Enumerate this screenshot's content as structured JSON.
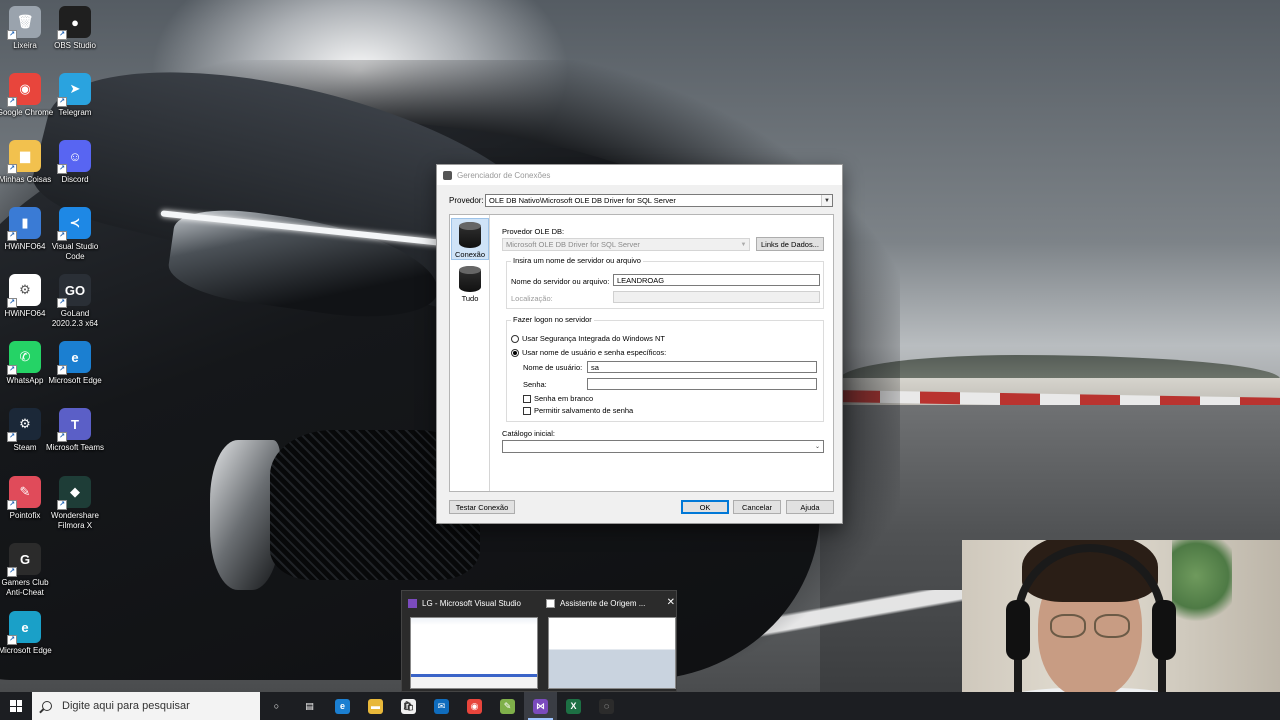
{
  "desktop": {
    "icons": [
      {
        "label": "Lixeira",
        "icon": "recycle-bin-icon",
        "color": "#9aa3ad",
        "glyph": "🗑"
      },
      {
        "label": "OBS Studio",
        "icon": "obs-icon",
        "color": "#1f1f1f",
        "glyph": "●"
      },
      {
        "label": "Google Chrome",
        "icon": "chrome-icon",
        "color": "#e8453c",
        "glyph": "◉"
      },
      {
        "label": "Telegram",
        "icon": "telegram-icon",
        "color": "#2aa3df",
        "glyph": "➤"
      },
      {
        "label": "Minhas Coisas",
        "icon": "folder-icon",
        "color": "#f2c14e",
        "glyph": "▆"
      },
      {
        "label": "Discord",
        "icon": "discord-icon",
        "color": "#5865f2",
        "glyph": "☺"
      },
      {
        "label": "HWiNFO64",
        "icon": "hwinfo-icon",
        "color": "#3a7bd5",
        "glyph": "▮"
      },
      {
        "label": "Visual Studio Code",
        "icon": "vscode-icon",
        "color": "#1e88e5",
        "glyph": "≺"
      },
      {
        "label": "HWiNFO64",
        "icon": "file-icon",
        "color": "#ffffff",
        "glyph": "⚙"
      },
      {
        "label": "GoLand 2020.2.3 x64",
        "icon": "goland-icon",
        "color": "#2a2f36",
        "glyph": "GO"
      },
      {
        "label": "WhatsApp",
        "icon": "whatsapp-icon",
        "color": "#25d366",
        "glyph": "✆"
      },
      {
        "label": "Microsoft Edge",
        "icon": "edge-icon",
        "color": "#1b7fd1",
        "glyph": "e"
      },
      {
        "label": "Steam",
        "icon": "steam-icon",
        "color": "#1b2838",
        "glyph": "⚙"
      },
      {
        "label": "Microsoft Teams",
        "icon": "teams-icon",
        "color": "#5b5fc7",
        "glyph": "T"
      },
      {
        "label": "Pointofix",
        "icon": "pointofix-icon",
        "color": "#e04b5a",
        "glyph": "✎"
      },
      {
        "label": "Wondershare Filmora X",
        "icon": "filmora-icon",
        "color": "#1e3d37",
        "glyph": "◆"
      },
      {
        "label": "Gamers Club Anti-Cheat",
        "icon": "gamersclub-icon",
        "color": "#2b2b2b",
        "glyph": "G"
      },
      {
        "label": "Microsoft Edge",
        "icon": "edge-icon",
        "color": "#1aa0c8",
        "glyph": "e"
      }
    ]
  },
  "dialog": {
    "title": "Gerenciador de Conexões",
    "provider_label": "Provedor:",
    "provider_value": "OLE DB Nativo\\Microsoft OLE DB Driver for SQL Server",
    "nav": [
      {
        "label": "Conexão",
        "selected": true
      },
      {
        "label": "Tudo",
        "selected": false
      }
    ],
    "ole_label": "Provedor OLE DB:",
    "ole_value": "Microsoft OLE DB Driver for SQL Server",
    "data_links_button": "Links de Dados...",
    "server_group_title": "Insira um nome de servidor ou arquivo",
    "server_label": "Nome do servidor ou arquivo:",
    "server_value": "LEANDROAG",
    "location_label": "Localização:",
    "logon_group_title": "Fazer logon no servidor",
    "radio_nt": "Usar Segurança Integrada do Windows NT",
    "radio_user": "Usar nome de usuário e senha específicos:",
    "user_label": "Nome de usuário:",
    "user_value": "sa",
    "password_label": "Senha:",
    "password_value": "",
    "blank_password": "Senha em branco",
    "save_password": "Permitir salvamento de senha",
    "catalog_label": "Catálogo inicial:",
    "catalog_value": "",
    "test_button": "Testar Conexão",
    "ok_button": "OK",
    "cancel_button": "Cancelar",
    "help_button": "Ajuda"
  },
  "taskbar": {
    "search_placeholder": "Digite aqui para pesquisar",
    "apps": [
      {
        "icon": "cortana-icon",
        "color": "#1c1e22",
        "glyph": "○"
      },
      {
        "icon": "task-view-icon",
        "color": "#1c1e22",
        "glyph": "▤"
      },
      {
        "icon": "edge-icon",
        "color": "#1b7fd1",
        "glyph": "e"
      },
      {
        "icon": "file-explorer-icon",
        "color": "#e8b83a",
        "glyph": "▬"
      },
      {
        "icon": "store-icon",
        "color": "#f0f0f0",
        "glyph": "🛍"
      },
      {
        "icon": "mail-icon",
        "color": "#0f6cbd",
        "glyph": "✉"
      },
      {
        "icon": "chrome-icon",
        "color": "#e8453c",
        "glyph": "◉"
      },
      {
        "icon": "notepad-icon",
        "color": "#7fb04a",
        "glyph": "✎"
      },
      {
        "icon": "visual-studio-icon",
        "color": "#7b4bbd",
        "glyph": "⋈",
        "active": true
      },
      {
        "icon": "excel-icon",
        "color": "#1d7044",
        "glyph": "X"
      },
      {
        "icon": "obs-icon",
        "color": "#2b2b2b",
        "glyph": "◌"
      }
    ]
  },
  "thumbnails": [
    {
      "title": "LG - Microsoft Visual Studio",
      "icon": "visual-studio-icon",
      "color": "#7b4bbd"
    },
    {
      "title": "Assistente de Origem ...",
      "icon": "wizard-icon",
      "color": "#ffffff"
    }
  ]
}
